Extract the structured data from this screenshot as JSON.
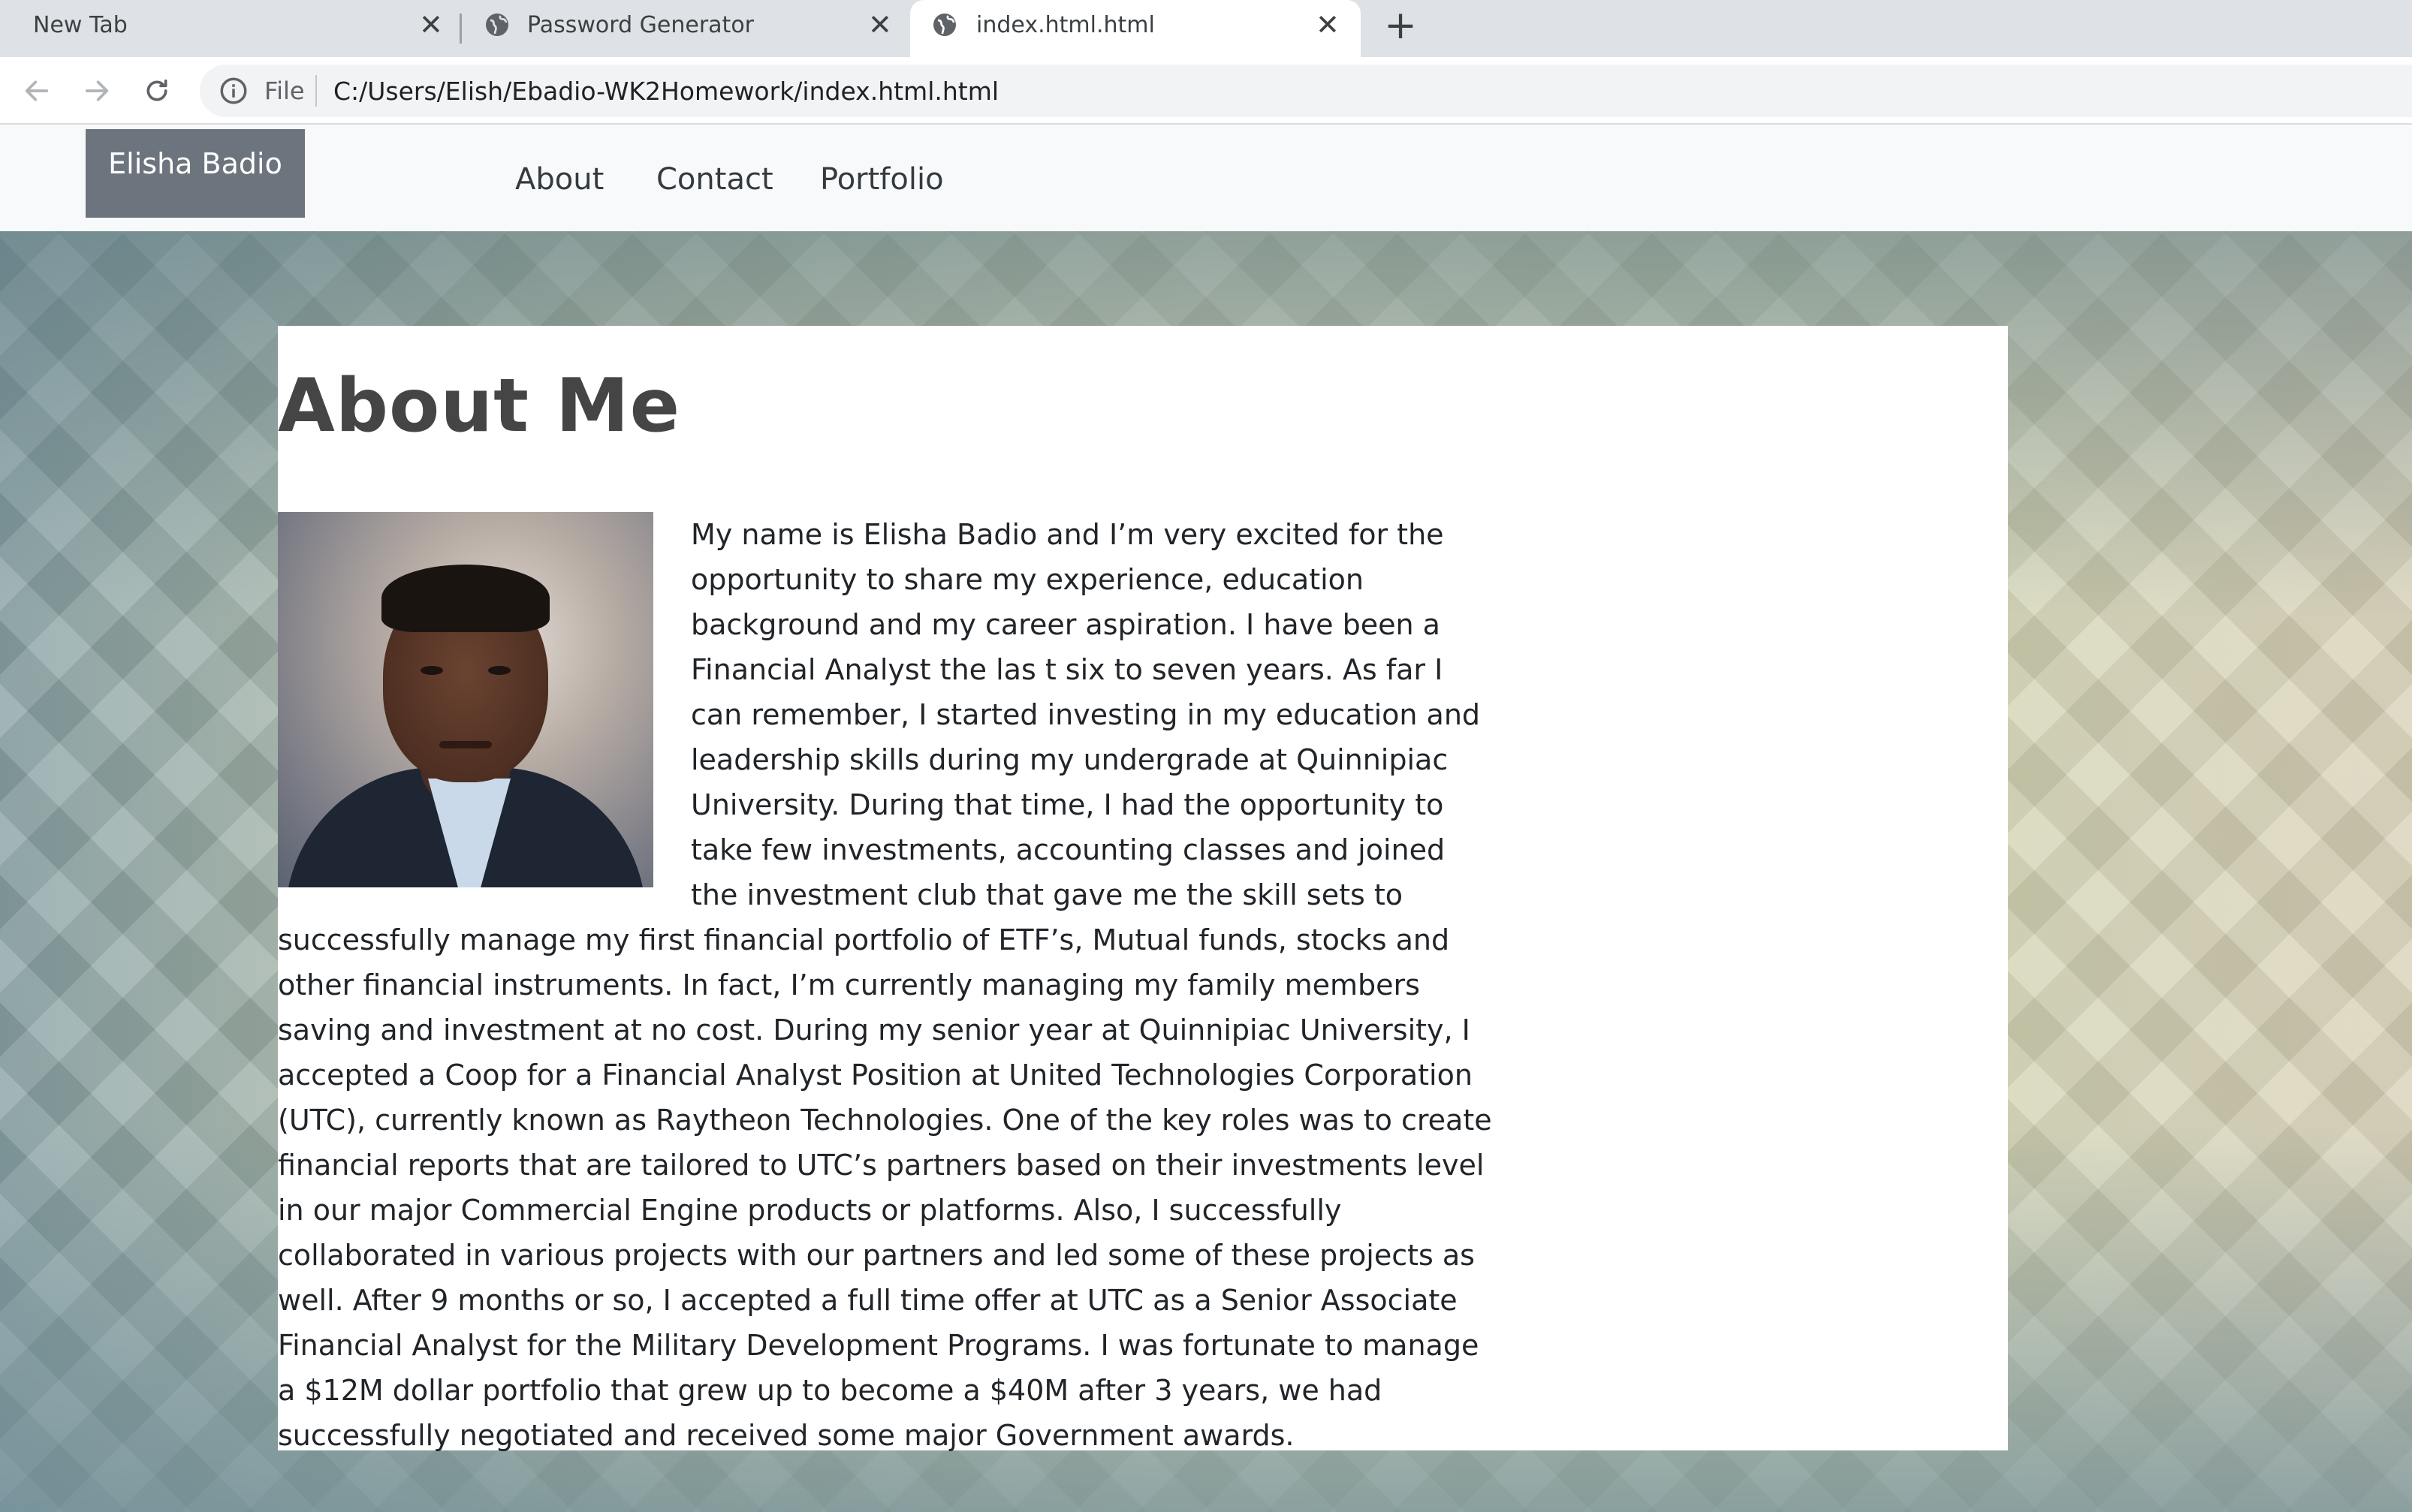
{
  "browser": {
    "tabs": [
      {
        "title": "New Tab"
      },
      {
        "title": "Password Generator"
      },
      {
        "title": "index.html.html"
      }
    ],
    "close_glyph": "✕",
    "new_tab_glyph": "+",
    "omnibox": {
      "scheme_label": "File",
      "url": "C:/Users/Elish/Ebadio-WK2Homework/index.html.html"
    }
  },
  "site": {
    "brand": "Elisha Badio",
    "nav": [
      {
        "label": "About"
      },
      {
        "label": "Contact"
      },
      {
        "label": "Portfolio"
      }
    ],
    "about": {
      "heading": "About Me",
      "bio": "My name is Elisha Badio and I’m very excited for the opportunity to share my experience, education background and my career aspiration. I have been a Financial Analyst the las t six to seven years. As far I can remember, I started investing in my education and leadership skills during my undergrade at Quinnipiac University. During that time, I had the opportunity to take few investments, accounting classes and joined the investment club that gave me the skill sets to successfully manage my first financial portfolio of ETF’s, Mutual funds, stocks and other financial instruments. In fact, I’m currently managing my family members saving and investment at no cost. During my senior year at Quinnipiac University, I accepted a Coop for a Financial Analyst Position at United Technologies Corporation (UTC), currently known as Raytheon Technologies. One of the key roles was to create financial reports that are tailored to UTC’s partners based on their investments level in our major Commercial Engine products or platforms. Also, I successfully collaborated in various projects with our partners and led some of these projects as well. After 9 months or so, I accepted a full time offer at UTC as a Senior Associate Financial Analyst for the Military Development Programs. I was fortunate to manage a $12M dollar portfolio that grew up to become a $40M after 3 years, we had successfully negotiated and received some major Government awards."
    }
  },
  "colors": {
    "tabstrip_bg": "#dee1e6",
    "navbar_bg": "#f8f9fa",
    "brand_bg": "#6c757d",
    "heading": "#454545"
  },
  "icons": {
    "back": "arrow-back-icon",
    "forward": "arrow-forward-icon",
    "reload": "reload-icon",
    "info": "info-icon",
    "favicon": "globe-icon"
  }
}
